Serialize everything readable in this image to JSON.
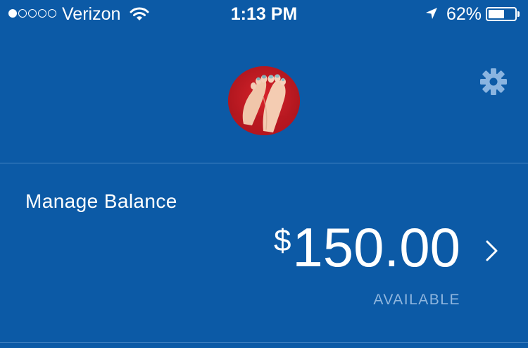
{
  "status_bar": {
    "signal_dots_filled": 1,
    "signal_dots_total": 5,
    "carrier": "Verizon",
    "wifi_icon": "wifi-icon",
    "time": "1:13 PM",
    "location_icon": "location-arrow-icon",
    "battery_percent_label": "62%",
    "battery_level": 0.62
  },
  "header": {
    "avatar": "profile-photo",
    "settings_icon": "gear-icon"
  },
  "balance": {
    "title": "Manage Balance",
    "currency_symbol": "$",
    "amount": "150.00",
    "status": "AVAILABLE",
    "chevron_icon": "chevron-right-icon"
  },
  "colors": {
    "background": "#0c5aa6",
    "text": "#ffffff",
    "muted_text": "#8fb6de",
    "settings_icon": "#8ab4e0"
  }
}
